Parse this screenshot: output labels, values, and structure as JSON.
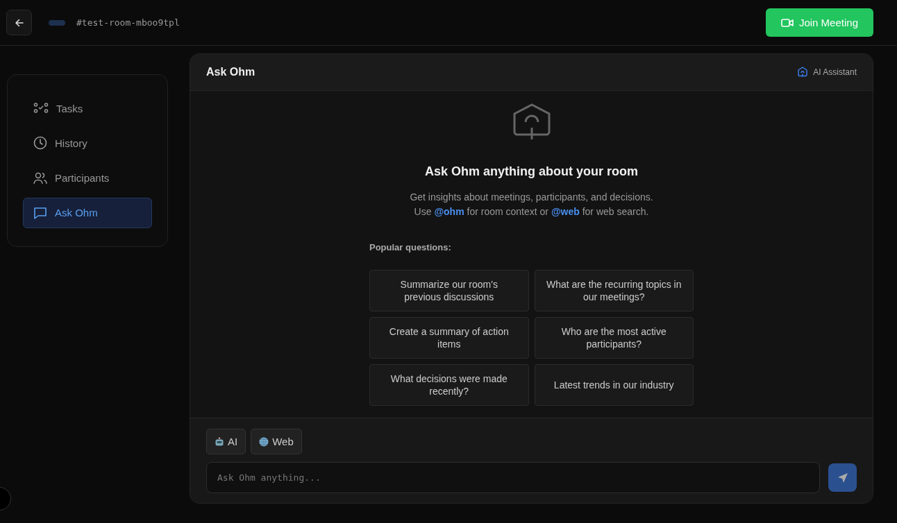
{
  "topbar": {
    "room": "#test-room-mboo9tpl",
    "join_button": "Join Meeting"
  },
  "sidebar": {
    "items": [
      {
        "label": "Tasks",
        "kind": "tasks",
        "selected": false
      },
      {
        "label": "History",
        "kind": "history",
        "selected": false
      },
      {
        "label": "Participants",
        "kind": "participants",
        "selected": false
      },
      {
        "label": "Ask Ohm",
        "kind": "chat",
        "selected": true
      }
    ]
  },
  "panel": {
    "title": "Ask Ohm",
    "badge": "AI Assistant",
    "heading": "Ask Ohm anything about your room",
    "description": [
      "Get insights about meetings, participants, and decisions.",
      "Use **@ohm** for room context or **@web** for web search."
    ],
    "popular_label": "Popular questions:",
    "questions": [
      "Summarize our room's previous discussions",
      "What are the recurring topics in our meetings?",
      "Create a summary of action items",
      "Who are the most active participants?",
      "What decisions were made recently?",
      "Latest trends in our industry"
    ],
    "modes": [
      {
        "label": "AI",
        "kind": "robot"
      },
      {
        "label": "Web",
        "kind": "globe"
      }
    ],
    "input": {
      "placeholder": "Ask Ohm anything..."
    }
  }
}
